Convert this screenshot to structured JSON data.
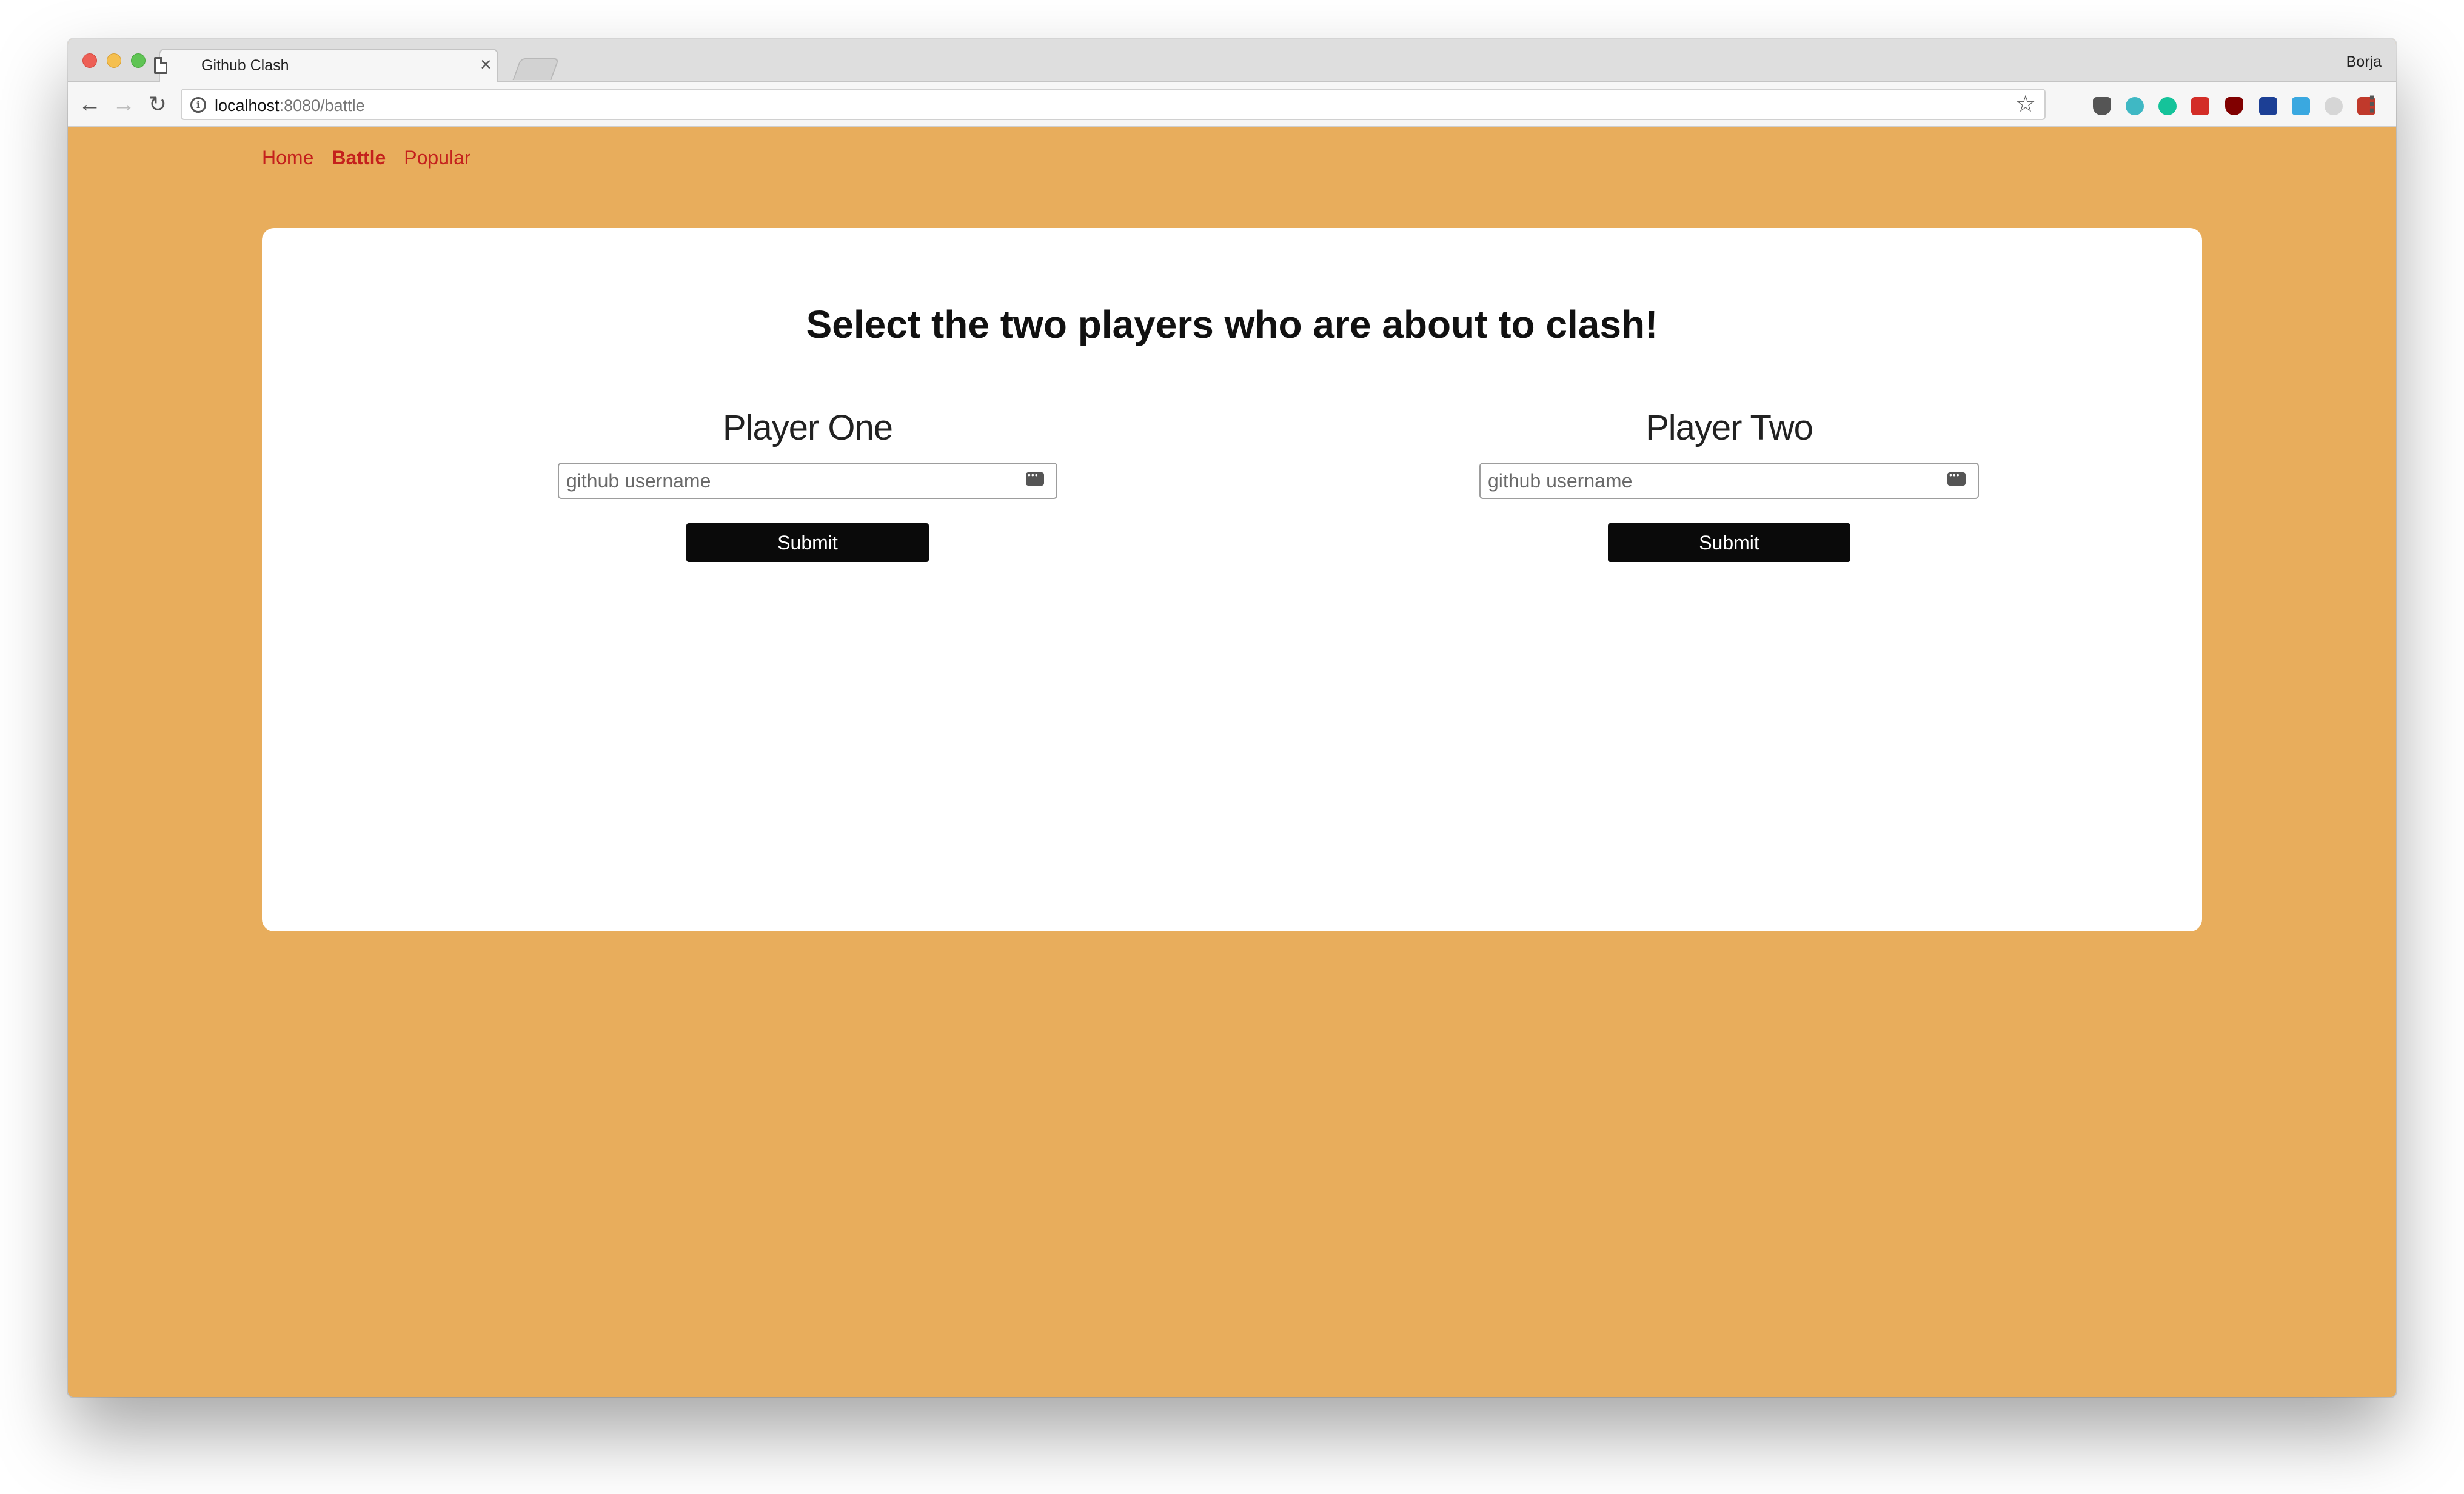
{
  "browser": {
    "tab_title": "Github Clash",
    "profile_name": "Borja",
    "url_host": "localhost",
    "url_path": ":8080/battle",
    "extension_icons": [
      "pocket-icon",
      "circle-ext-icon",
      "grammarly-icon",
      "lastpass-icon",
      "ublock-icon",
      "ext-60-icon",
      "g-ext-icon",
      "search-ext-icon",
      "ext-red-icon"
    ]
  },
  "nav": {
    "home": "Home",
    "battle": "Battle",
    "popular": "Popular"
  },
  "page": {
    "heading": "Select the two players who are about to clash!"
  },
  "players": {
    "one": {
      "title": "Player One",
      "placeholder": "github username",
      "value": "",
      "submit_label": "Submit"
    },
    "two": {
      "title": "Player Two",
      "placeholder": "github username",
      "value": "",
      "submit_label": "Submit"
    }
  },
  "colors": {
    "background": "#e8ad5c",
    "nav_link": "#c4211d",
    "button": "#0a0a0a",
    "card": "#ffffff"
  }
}
